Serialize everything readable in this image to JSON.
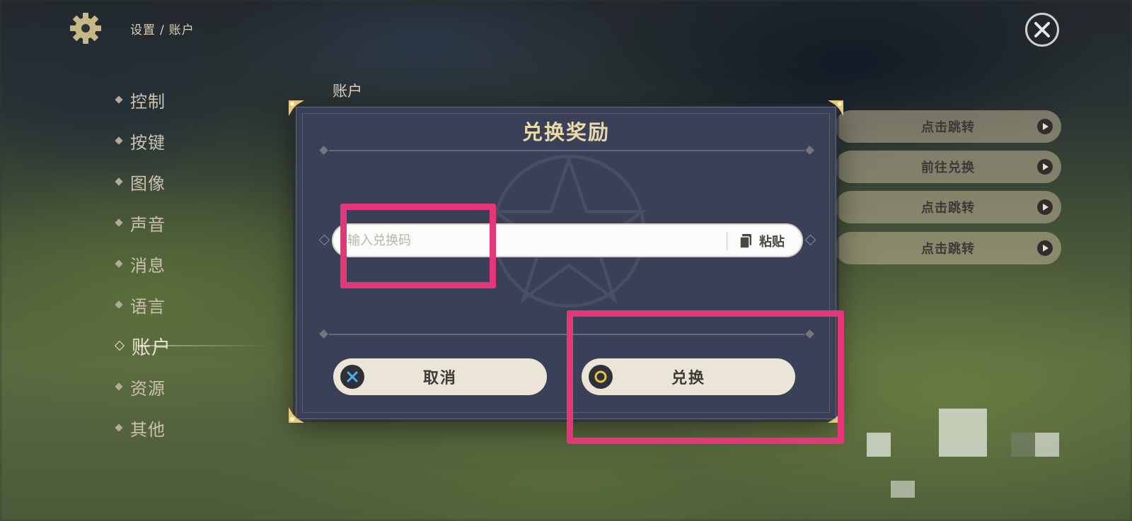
{
  "header": {
    "breadcrumb": [
      "设置",
      "账户"
    ],
    "separator": "/"
  },
  "icons": {
    "settings": "gear-icon",
    "close": "close-icon"
  },
  "sidebar": {
    "items": [
      {
        "label": "控制",
        "active": false
      },
      {
        "label": "按键",
        "active": false
      },
      {
        "label": "图像",
        "active": false
      },
      {
        "label": "声音",
        "active": false
      },
      {
        "label": "消息",
        "active": false
      },
      {
        "label": "语言",
        "active": false
      },
      {
        "label": "账户",
        "active": true
      },
      {
        "label": "资源",
        "active": false
      },
      {
        "label": "其他",
        "active": false
      }
    ]
  },
  "main": {
    "section_title": "账户",
    "right_buttons": [
      {
        "label": "点击跳转"
      },
      {
        "label": "前往兑换"
      },
      {
        "label": "点击跳转"
      },
      {
        "label": "点击跳转"
      }
    ]
  },
  "dialog": {
    "title": "兑换奖励",
    "input": {
      "value": "",
      "placeholder": "输入兑换码"
    },
    "paste_label": "粘贴",
    "cancel_label": "取消",
    "confirm_label": "兑换"
  },
  "colors": {
    "highlight": "#e43779",
    "dialog_bg": "#3a4058",
    "title_gold": "#e8d9a8",
    "button_bg": "#ebe5d7"
  }
}
